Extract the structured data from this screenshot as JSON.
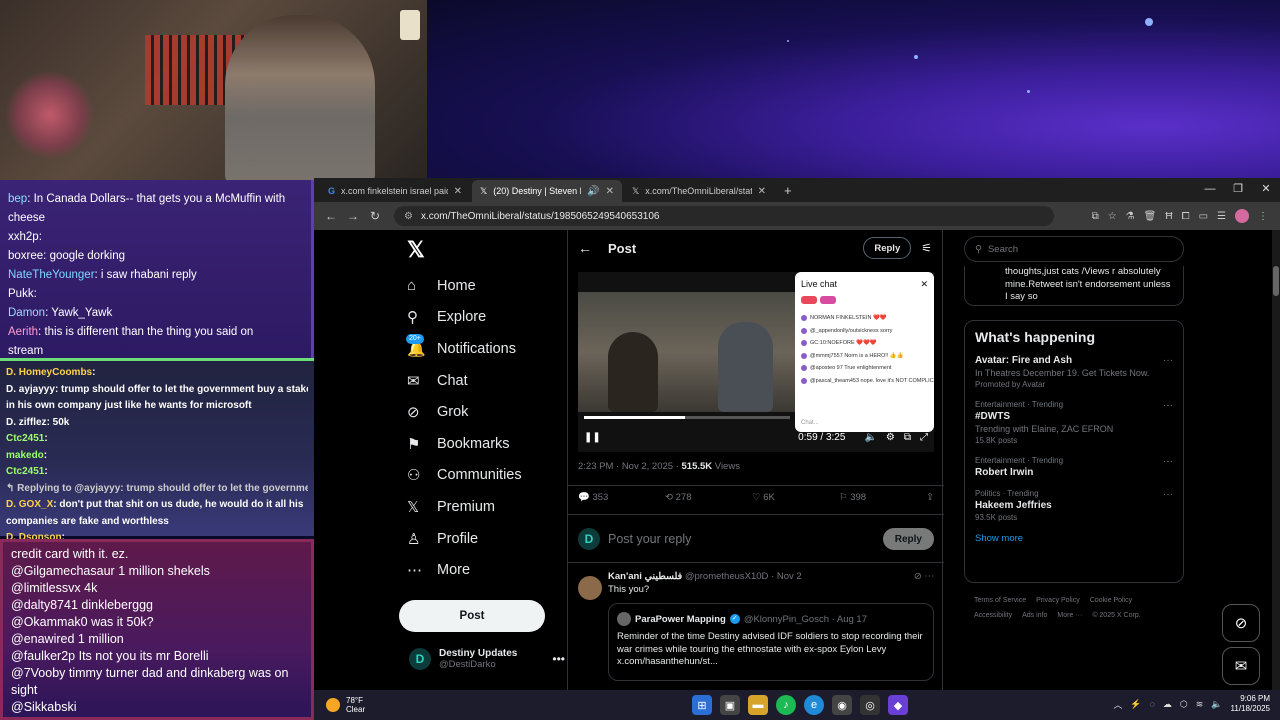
{
  "chat_top": [
    {
      "user": "bep",
      "color": "#8be0ff",
      "msg": "In Canada Dollars-- that gets you a McMuffin with"
    },
    {
      "user": "",
      "color": "#ffffff",
      "msg": "cheese"
    },
    {
      "user": "xxh2p",
      "color": "#ffffff",
      "msg": ""
    },
    {
      "user": "boxree",
      "color": "#ffffff",
      "msg": "google dorking"
    },
    {
      "user": "NateTheYounger",
      "color": "#7fd6ff",
      "msg": "i saw rhabani reply"
    },
    {
      "user": "Pukk",
      "color": "#ffffff",
      "msg": ""
    },
    {
      "user": "Damon",
      "color": "#a9d3ff",
      "msg": "Yawk_Yawk"
    },
    {
      "user": "Aerith",
      "color": "#ff9ed2",
      "msg": "this is different than the thing you said on"
    },
    {
      "user": "",
      "color": "#ffffff",
      "msg": "stream"
    }
  ],
  "chat_mid": [
    {
      "user": "D. HomeyCoombs",
      "color": "#ffd24a",
      "msg": ""
    },
    {
      "user": "D. ayjayyy",
      "color": "#ffffff",
      "msg": "trump should offer to let the government buy a stake"
    },
    {
      "user": "",
      "color": "#ffffff",
      "msg": "in his own company just like he wants for microsoft"
    },
    {
      "user": "D. zifflez",
      "color": "#ffffff",
      "msg": "50k"
    },
    {
      "user": "Ctc2451",
      "color": "#9bff6a",
      "msg": ""
    },
    {
      "user": "makedo",
      "color": "#9bff6a",
      "msg": ""
    },
    {
      "user": "Ctc2451",
      "color": "#9bff6a",
      "msg": ""
    },
    {
      "user": "",
      "color": "#cccccc",
      "msg": "↰ Replying to @ayjayyy: trump should offer to let the government buy a stake ..."
    },
    {
      "user": "D. GOX_X",
      "color": "#ffd24a",
      "msg": "don't put that shit on us dude, he would do it all his"
    },
    {
      "user": "",
      "color": "#ffffff",
      "msg": "companies are fake and worthless"
    },
    {
      "user": "D. Dsonson",
      "color": "#ffd24a",
      "msg": ""
    }
  ],
  "chat_bot": [
    {
      "user": "",
      "msg": "credit card with it. ez."
    },
    {
      "user": "@Gilgamechasaur",
      "msg": "1 million shekels"
    },
    {
      "user": "@limitlessvx",
      "msg": "4k"
    },
    {
      "user": "@dalty8741",
      "msg": "dinkleberggg"
    },
    {
      "user": "@Okammak0",
      "msg": "was it 50k?"
    },
    {
      "user": "@enawired",
      "msg": "1 million"
    },
    {
      "user": "@faulker2p",
      "msg": "Its not you its mr Borelli"
    },
    {
      "user": "@7Vooby",
      "msg": "timmy turner dad and dinkaberg was on"
    },
    {
      "user": "",
      "msg": "sight"
    },
    {
      "user": "@Sikkabski",
      "msg": ""
    }
  ],
  "browser": {
    "tabs": [
      {
        "title": "x.com finkelstein israel paid the",
        "active": false
      },
      {
        "title": "(20) Destiny | Steven Bonne",
        "active": true
      },
      {
        "title": "x.com/TheOmniLiberal/status/1",
        "active": false
      }
    ],
    "new_tab": "+",
    "url": "x.com/TheOmniLiberal/status/1985065249540653106"
  },
  "nav": {
    "logo": "𝕏",
    "items": [
      {
        "key": "home",
        "icon": "⌂",
        "label": "Home"
      },
      {
        "key": "explore",
        "icon": "⚲",
        "label": "Explore"
      },
      {
        "key": "notifications",
        "icon": "🔔",
        "label": "Notifications",
        "badge": "20+"
      },
      {
        "key": "chat",
        "icon": "✉",
        "label": "Chat"
      },
      {
        "key": "grok",
        "icon": "⊘",
        "label": "Grok"
      },
      {
        "key": "bookmarks",
        "icon": "⚑",
        "label": "Bookmarks"
      },
      {
        "key": "communities",
        "icon": "⚇",
        "label": "Communities"
      },
      {
        "key": "premium",
        "icon": "𝕏",
        "label": "Premium"
      },
      {
        "key": "profile",
        "icon": "♙",
        "label": "Profile"
      },
      {
        "key": "more",
        "icon": "⋯",
        "label": "More"
      }
    ],
    "post_label": "Post",
    "account": {
      "name": "Destiny Updates",
      "handle": "@DestiDarko",
      "avatar": "D"
    }
  },
  "post": {
    "title": "Post",
    "reply_label": "Reply",
    "video": {
      "time": "0:59 / 3:25",
      "progress": 0.49,
      "live_chat": {
        "title": "Live chat",
        "rows": [
          "NORMAN FINKELSTEIN ❤️❤️",
          "@_appendonlly/outsickness sorry",
          "GC:10:NOEFORE ❤️❤️❤️",
          "@mmmj7557 Norm is a HERO!! 👍👍",
          "@aposteo 97 True enlightenment",
          "@pascal_theam453 nope. love it's NOT COMPLICATED DUH"
        ],
        "input": "Chat..."
      }
    },
    "meta": {
      "time": "2:23 PM · Nov 2, 2025 · ",
      "views": "515.5K",
      "views_label": " Views"
    },
    "actions": {
      "replies": "353",
      "reposts": "278",
      "likes": "6K",
      "bookmarks": "398"
    },
    "compose_placeholder": "Post your reply",
    "compose_button": "Reply",
    "reply": {
      "name": "Kan'ani فلسطيني",
      "handle": "@prometheusX10D · Nov 2",
      "text": "This you?",
      "quote": {
        "name": "ParaPower Mapping",
        "handle": "@KlonnyPin_Gosch · Aug 17",
        "text": "Reminder of the time Destiny advised IDF soldiers to stop recording their war crimes while touring the ethnostate with ex-spox Eylon Levy x.com/hasanthehun/st..."
      }
    }
  },
  "right": {
    "search_placeholder": "Search",
    "preview_text": "thoughts,just cats /Views r absolutely mine.Retweet isn't endorsement unless I say so",
    "whats_title": "What's happening",
    "trends": [
      {
        "ctx": "",
        "title": "Avatar: Fire and Ash",
        "sub": "In Theatres December 19. Get Tickets Now.",
        "sub2": "Promoted by Avatar"
      },
      {
        "ctx": "Entertainment · Trending",
        "title": "#DWTS",
        "sub": "Trending with Elaine, ZAC EFRON",
        "sub2": "15.8K posts"
      },
      {
        "ctx": "Entertainment · Trending",
        "title": "Robert Irwin",
        "sub": "",
        "sub2": ""
      },
      {
        "ctx": "Politics · Trending",
        "title": "Hakeem Jeffries",
        "sub": "",
        "sub2": "93.5K posts"
      }
    ],
    "show_more": "Show more",
    "footer": [
      "Terms of Service",
      "Privacy Policy",
      "Cookie Policy",
      "Accessibility",
      "Ads info",
      "More ···",
      "© 2025 X Corp."
    ]
  },
  "taskbar": {
    "temp": "78°F",
    "condition": "Clear",
    "time": "9:06 PM",
    "date": "11/18/2025"
  }
}
